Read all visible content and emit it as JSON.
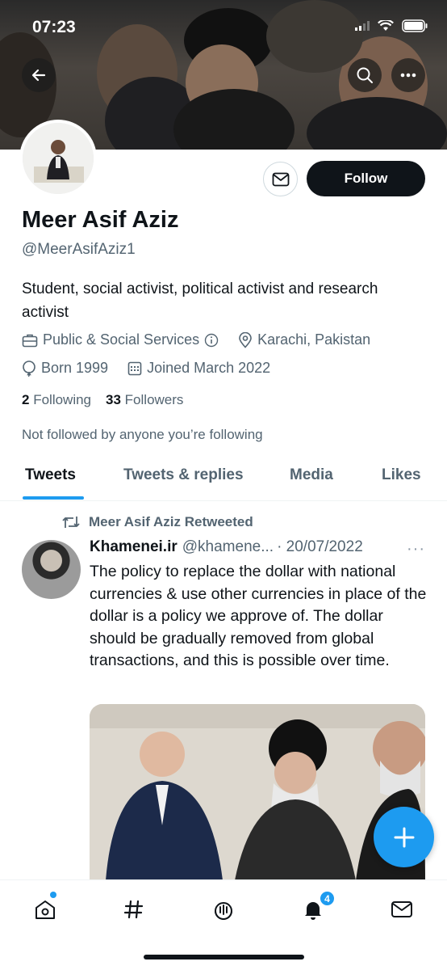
{
  "status_bar": {
    "time": "07:23"
  },
  "profile": {
    "name": "Meer Asif Aziz",
    "handle": "@MeerAsifAziz1",
    "bio": "Student, social activist, political activist and research activist",
    "category": "Public & Social Services",
    "location": "Karachi, Pakistan",
    "born": "Born 1999",
    "joined": "Joined March 2022",
    "following_count": "2",
    "following_label": "Following",
    "followers_count": "33",
    "followers_label": "Followers",
    "not_followed_text": "Not followed by anyone you’re following",
    "follow_button": "Follow"
  },
  "tabs": [
    {
      "label": "Tweets",
      "active": true
    },
    {
      "label": "Tweets & replies",
      "active": false
    },
    {
      "label": "Media",
      "active": false
    },
    {
      "label": "Likes",
      "active": false
    }
  ],
  "tweet": {
    "retweet_label": "Meer Asif Aziz Retweeted",
    "author": "Khamenei.ir",
    "handle": "@khamene...",
    "date": "· 20/07/2022",
    "more": "···",
    "text": "The policy to replace the dollar with national currencies & use other currencies in place of the dollar is a policy we approve of. The dollar should be gradually removed from global transactions, and this is possible over time."
  },
  "bottom_nav": {
    "notification_badge": "4"
  },
  "icons": [
    "back-icon",
    "search-icon",
    "more-icon",
    "message-icon",
    "briefcase-icon",
    "info-icon",
    "location-icon",
    "balloon-icon",
    "calendar-icon",
    "retweet-icon",
    "compose-icon",
    "home-icon",
    "hashtag-icon",
    "spaces-icon",
    "bell-icon",
    "mail-icon"
  ],
  "colors": {
    "accent": "#1d9bf0",
    "text": "#0f1419",
    "secondary": "#536471",
    "follow_bg": "#0f1419"
  }
}
